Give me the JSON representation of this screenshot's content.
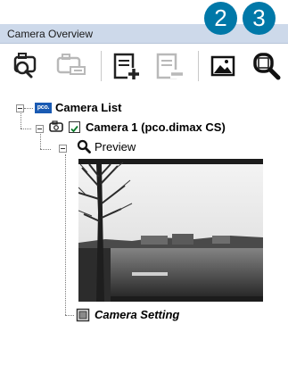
{
  "panel": {
    "title": "Camera Overview"
  },
  "callouts": [
    "2",
    "3"
  ],
  "toolbar": {
    "buttons": [
      {
        "icon": "camera-search-icon",
        "enabled": true
      },
      {
        "icon": "camera-remove-icon",
        "enabled": false
      },
      {
        "icon": "add-setting-icon",
        "enabled": true
      },
      {
        "icon": "remove-setting-icon",
        "enabled": false
      },
      {
        "icon": "image-icon",
        "enabled": true
      },
      {
        "icon": "magnifier-icon",
        "enabled": true
      }
    ]
  },
  "tree": {
    "root": {
      "label": "Camera List",
      "logo": "pco."
    },
    "camera": {
      "label": "Camera 1 (pco.dimax CS)",
      "checked": true
    },
    "preview": {
      "label": "Preview"
    },
    "setting": {
      "label": "Camera Setting"
    }
  }
}
